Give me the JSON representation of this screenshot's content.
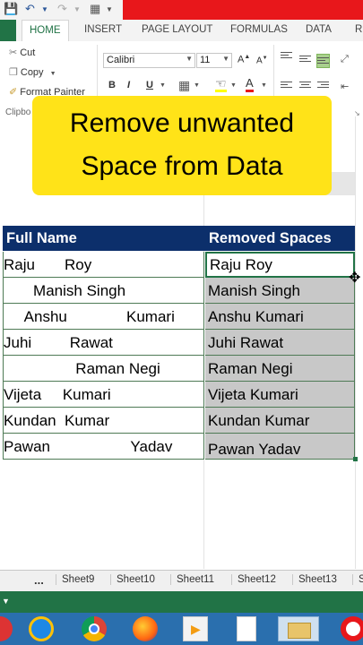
{
  "ribbon": {
    "tabs": [
      "HOME",
      "INSERT",
      "PAGE LAYOUT",
      "FORMULAS",
      "DATA",
      "R"
    ],
    "clipboard": {
      "cut": "Cut",
      "copy": "Copy",
      "format_painter": "Format Painter",
      "group_label": "Clipbo"
    },
    "font": {
      "name": "Calibri",
      "size": "11",
      "bold": "B",
      "italic": "I",
      "underline": "U"
    }
  },
  "banner": {
    "line1": "Remove unwanted",
    "line2": "Space from Data"
  },
  "table": {
    "headers": [
      "Full Name",
      "Removed Spaces"
    ],
    "rows": [
      {
        "full": "Raju       Roy",
        "clean": "Raju Roy"
      },
      {
        "full": "       Manish Singh",
        "clean": "Manish Singh"
      },
      {
        "full": "     Anshu              Kumari",
        "clean": "Anshu Kumari"
      },
      {
        "full": "Juhi         Rawat",
        "clean": "Juhi Rawat"
      },
      {
        "full": "                 Raman Negi",
        "clean": "Raman Negi"
      },
      {
        "full": "Vijeta     Kumari",
        "clean": "Vijeta Kumari"
      },
      {
        "full": "Kundan  Kumar",
        "clean": "Kundan Kumar"
      },
      {
        "full": "Pawan                   Yadav",
        "clean": "Pawan Yadav"
      }
    ]
  },
  "sheets": {
    "more": "...",
    "tabs": [
      "Sheet9",
      "Sheet10",
      "Sheet11",
      "Sheet12",
      "Sheet13",
      "S"
    ]
  },
  "colors": {
    "excel_green": "#217346",
    "header_navy": "#0c2f6b",
    "banner_yellow": "#ffe318",
    "selection_gray": "#c8c8c8",
    "title_red": "#e8171b"
  },
  "taskbar_icons": [
    "windows-explorer-icon",
    "internet-explorer-icon",
    "chrome-icon",
    "firefox-icon",
    "media-player-icon",
    "file-icon",
    "file-explorer-icon",
    "opera-icon"
  ]
}
